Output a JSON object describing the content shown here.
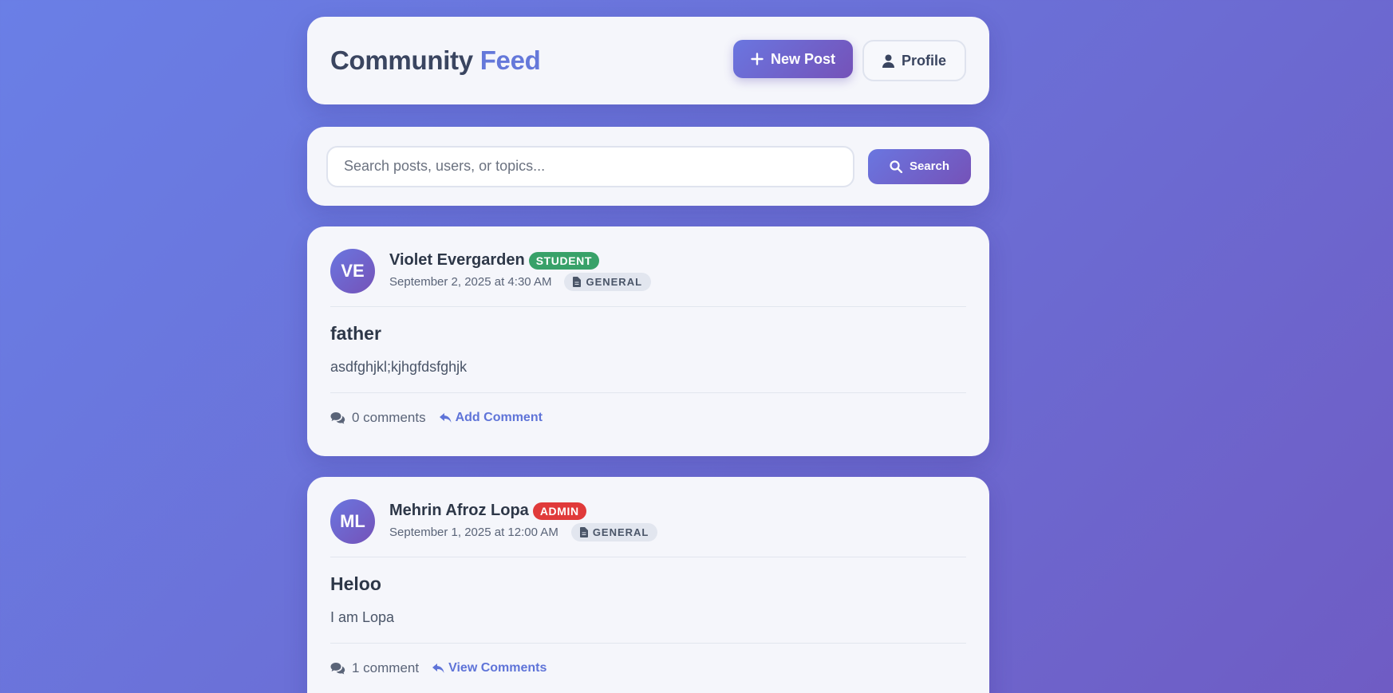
{
  "header": {
    "brand_part1": "Community",
    "brand_part2": "Feed",
    "new_post_label": "New Post",
    "profile_label": "Profile"
  },
  "search": {
    "placeholder": "Search posts, users, or topics...",
    "value": "",
    "button_label": "Search"
  },
  "posts": [
    {
      "initials": "VE",
      "author": "Violet Evergarden",
      "role": "STUDENT",
      "timestamp": "September 2, 2025 at 4:30 AM",
      "category": "GENERAL",
      "title": "father",
      "body": "asdfghjkl;kjhgfdsfghjk",
      "comment_count": "0 comments",
      "action_label": "Add Comment"
    },
    {
      "initials": "ML",
      "author": "Mehrin Afroz Lopa",
      "role": "ADMIN",
      "timestamp": "September 1, 2025 at 12:00 AM",
      "category": "GENERAL",
      "title": "Heloo",
      "body": "I am Lopa",
      "comment_count": "1 comment",
      "action_label": "View Comments"
    }
  ],
  "colors": {
    "accent": "#6478da",
    "student_badge": "#38a169",
    "admin_badge": "#e03a3a",
    "link": "#5f74d8"
  },
  "icons": {
    "new_post": "plus-icon",
    "profile": "user-icon",
    "search": "search-icon",
    "category": "file-icon",
    "comments": "comments-icon",
    "action": "reply-icon"
  }
}
